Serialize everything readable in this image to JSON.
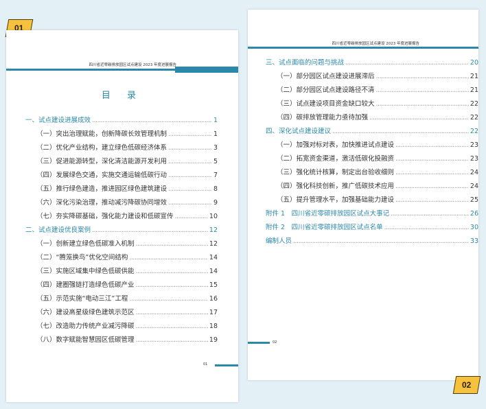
{
  "tags": {
    "first": "01",
    "second": "02"
  },
  "header_text": "四川省近零碳排放园区试点建设 2023 年度进展报告",
  "toc_title": "目 录",
  "page1_toc": [
    {
      "level": "sec",
      "title": "一、试点建设进展成效",
      "page": "1"
    },
    {
      "level": "sub",
      "title": "（一）突出治理赋能，创新降碳长效管理机制",
      "page": "1"
    },
    {
      "level": "sub",
      "title": "（二）优化产业结构，建立绿色低碳经济体系",
      "page": "3"
    },
    {
      "level": "sub",
      "title": "（三）促进能源转型，深化清洁能源开发利用",
      "page": "5"
    },
    {
      "level": "sub",
      "title": "（四）发展绿色交通，实施交通运输低碳行动",
      "page": "7"
    },
    {
      "level": "sub",
      "title": "（五）推行绿色建造，推进园区绿色建筑建设",
      "page": "8"
    },
    {
      "level": "sub",
      "title": "（六）深化污染治理，推动减污降碳协同增效",
      "page": "9"
    },
    {
      "level": "sub",
      "title": "（七）夯实降碳基础，强化能力建设和低碳宣传",
      "page": "10"
    },
    {
      "level": "sec",
      "title": "二、试点建设优良案例",
      "page": "12"
    },
    {
      "level": "sub",
      "title": "（一）创新建立绿色低碳准入机制",
      "page": "12"
    },
    {
      "level": "sub",
      "title": "（二）“腾笼换鸟”优化空间结构",
      "page": "14"
    },
    {
      "level": "sub",
      "title": "（三）实施区域集中绿色低碳供能",
      "page": "14"
    },
    {
      "level": "sub",
      "title": "（四）建圈强链打造绿色低碳产业",
      "page": "15"
    },
    {
      "level": "sub",
      "title": "（五）示范实施“电动三江”工程",
      "page": "16"
    },
    {
      "level": "sub",
      "title": "（六）建设高星级绿色建筑示范区",
      "page": "17"
    },
    {
      "level": "sub",
      "title": "（七）改造助力传统产业减污降碳",
      "page": "18"
    },
    {
      "level": "sub",
      "title": "（八）数字赋能智慧园区低碳管理",
      "page": "19"
    }
  ],
  "page2_toc": [
    {
      "level": "sec",
      "title": "三、试点面临的问题与挑战",
      "page": "20"
    },
    {
      "level": "sub",
      "title": "（一）部分园区试点建设进展滞后",
      "page": "21"
    },
    {
      "level": "sub",
      "title": "（二）部分园区试点建设路径不清",
      "page": "21"
    },
    {
      "level": "sub",
      "title": "（三）试点建设项目资金缺口较大",
      "page": "22"
    },
    {
      "level": "sub",
      "title": "（四）碳排放管理能力亟待加强",
      "page": "22"
    },
    {
      "level": "sec",
      "title": "四、深化试点建设建议",
      "page": "22"
    },
    {
      "level": "sub",
      "title": "（一）加强对标对表，加快推进试点建设",
      "page": "23"
    },
    {
      "level": "sub",
      "title": "（二）拓宽资金渠道，激活低碳化投融资",
      "page": "23"
    },
    {
      "level": "sub",
      "title": "（三）强化统计核算，制定出台验收细则",
      "page": "24"
    },
    {
      "level": "sub",
      "title": "（四）强化科技创新，推广低碳技术应用",
      "page": "24"
    },
    {
      "level": "sub",
      "title": "（五）提升管理水平，加强基础能力建设",
      "page": "25"
    },
    {
      "level": "sec",
      "title": "附件 1　四川省近零碳排放园区试点大事记",
      "page": "26"
    },
    {
      "level": "sec",
      "title": "附件 2　四川省近零碳排放园区试点名单",
      "page": "30"
    },
    {
      "level": "sec",
      "title": "编制人员",
      "page": "33"
    }
  ],
  "footer_page1": "01",
  "footer_page2": "02",
  "colors": {
    "accent": "#2a88a8",
    "tag": "#f6c23e",
    "background": "#e3f1f7"
  }
}
